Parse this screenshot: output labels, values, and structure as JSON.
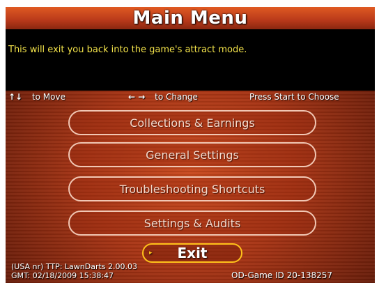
{
  "header": {
    "title": "Main Menu"
  },
  "description": "This will exit you back into the game's attract mode.",
  "help": {
    "move_arrows": "↑↓",
    "move_label": "to Move",
    "change_arrows": "← →",
    "change_label": "to Change",
    "start_label": "Press Start to Choose"
  },
  "menu": {
    "items": [
      {
        "label": "Collections & Earnings"
      },
      {
        "label": "General Settings"
      },
      {
        "label": "Troubleshooting Shortcuts"
      },
      {
        "label": "Settings & Audits"
      }
    ],
    "exit_label": "Exit",
    "selected": "Exit"
  },
  "footer": {
    "line1": "(USA nr) TTP: LawnDarts 2.00.03",
    "line2": "GMT: 02/18/2009 15:38:47",
    "game_id": "OD-Game ID 20-138257"
  },
  "colors": {
    "description_text": "#f2e24a",
    "selected_outline": "#ffc21a",
    "button_outline": "#f1c7b4"
  }
}
